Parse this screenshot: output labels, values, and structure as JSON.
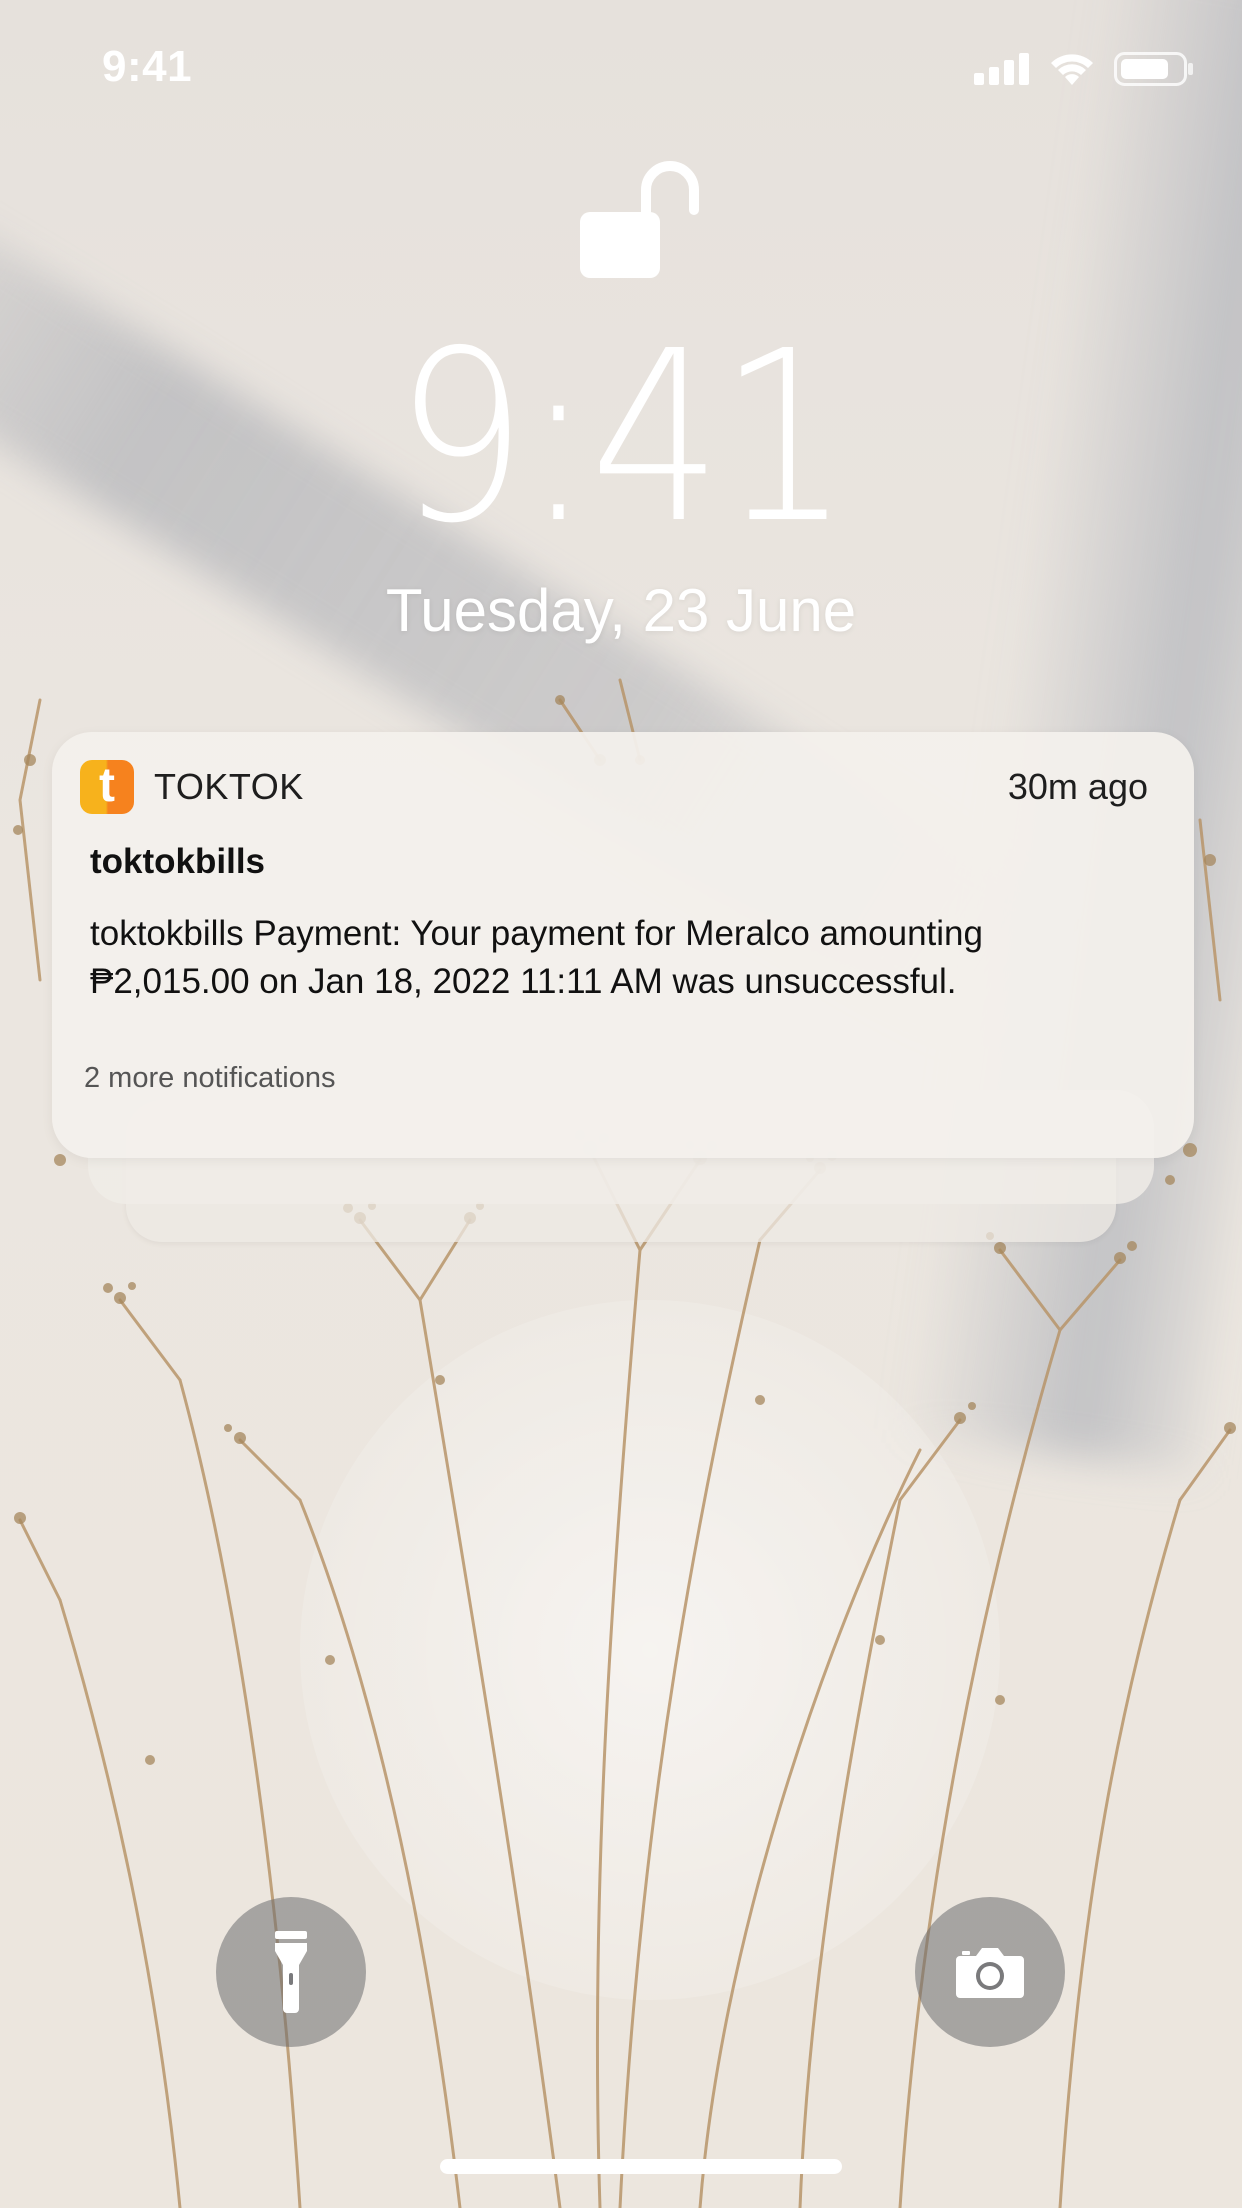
{
  "status_bar": {
    "time": "9:41",
    "icons": [
      "cellular-signal-icon",
      "wifi-icon",
      "battery-icon"
    ]
  },
  "lock_screen": {
    "lock_state_icon": "unlocked-padlock-icon",
    "time": "9:41",
    "date": "Tuesday, 23 June"
  },
  "notification": {
    "app_icon": "toktok-app-icon",
    "app_icon_letter": "t",
    "app_name": "TOKTOK",
    "time_ago": "30m ago",
    "title": "toktokbills",
    "body": "toktokbills Payment: Your payment for Meralco amounting ₱2,015.00 on Jan 18, 2022 11:11 AM was unsuccessful.",
    "more": "2 more notifications",
    "stacked_count": 2
  },
  "bottom_controls": {
    "left_button_icon": "flashlight-icon",
    "right_button_icon": "camera-icon"
  },
  "colors": {
    "text_on_wallpaper": "#ffffff",
    "app_icon_yellow": "#f7b21c",
    "app_icon_orange": "#f6821e",
    "notification_bg": "#f3f0ec"
  }
}
